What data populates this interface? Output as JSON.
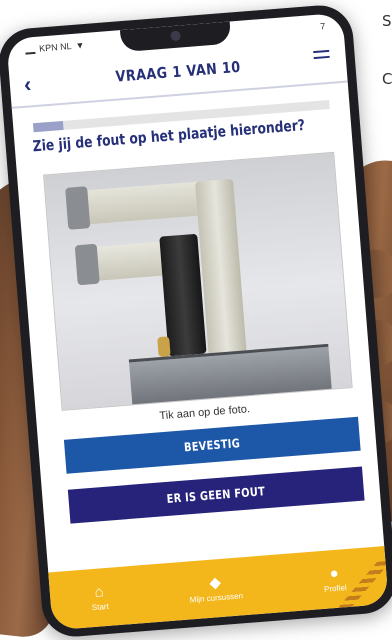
{
  "background": {
    "text_line1": "S",
    "text_line2": "C"
  },
  "status_bar": {
    "carrier": "KPN NL",
    "wifi_icon": "wifi-icon",
    "right": "7"
  },
  "header": {
    "title": "VRAAG 1 VAN 10",
    "back_icon": "chevron-left-icon",
    "menu_icon": "menu-icon"
  },
  "quiz": {
    "progress": 0.1,
    "question": "Zie jij de fout op het plaatje hieronder?",
    "photo": "photo-pipes-boiler",
    "hint": "Tik aan op de foto.",
    "confirm_label": "BEVESTIG",
    "no_fault_label": "ER IS GEEN FOUT"
  },
  "tabbar": {
    "items": [
      {
        "label": "Start",
        "icon": "home-icon"
      },
      {
        "label": "Mijn cursussen",
        "icon": "graduation-cap-icon"
      },
      {
        "label": "Profiel",
        "icon": "person-icon"
      }
    ]
  },
  "colors": {
    "primary": "#253079",
    "confirm": "#1c57a8",
    "no_fault": "#27237a",
    "tabbar": "#f3b71c",
    "accent_shape": "#2ec39a"
  }
}
